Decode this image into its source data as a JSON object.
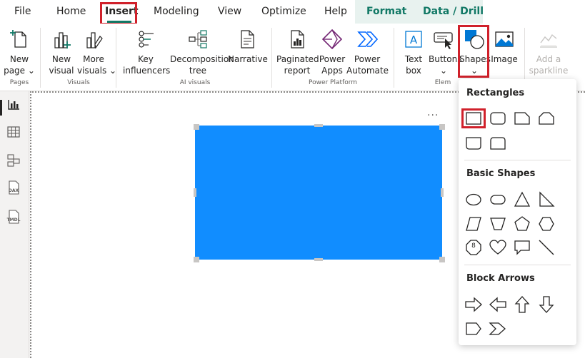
{
  "menubar": {
    "items": [
      {
        "label": "File"
      },
      {
        "label": "Home"
      },
      {
        "label": "Insert"
      },
      {
        "label": "Modeling"
      },
      {
        "label": "View"
      },
      {
        "label": "Optimize"
      },
      {
        "label": "Help"
      },
      {
        "label": "Format"
      },
      {
        "label": "Data / Drill"
      }
    ],
    "active_tab": "Insert"
  },
  "ribbon": {
    "groups": [
      {
        "label": "Pages"
      },
      {
        "label": "Visuals"
      },
      {
        "label": "AI visuals"
      },
      {
        "label": "Power Platform"
      },
      {
        "label": "Elem"
      }
    ],
    "buttons": {
      "new_page": {
        "line1": "New",
        "line2": "page ⌄"
      },
      "new_visual": {
        "line1": "New",
        "line2": "visual"
      },
      "more_visuals": {
        "line1": "More",
        "line2": "visuals ⌄"
      },
      "key_influencers": {
        "line1": "Key",
        "line2": "influencers"
      },
      "decomposition_tree": {
        "line1": "Decomposition",
        "line2": "tree"
      },
      "narrative": {
        "line1": "Narrative",
        "line2": ""
      },
      "paginated_report": {
        "line1": "Paginated",
        "line2": "report"
      },
      "power_apps": {
        "line1": "Power",
        "line2": "Apps"
      },
      "power_automate": {
        "line1": "Power",
        "line2": "Automate"
      },
      "text_box": {
        "line1": "Text",
        "line2": "box"
      },
      "buttons": {
        "line1": "Buttons",
        "line2": "⌄"
      },
      "shapes": {
        "line1": "Shapes",
        "line2": "⌄"
      },
      "image": {
        "line1": "Image",
        "line2": ""
      },
      "sparkline": {
        "line1": "Add a",
        "line2": "sparkline"
      }
    }
  },
  "rail": {
    "icons": [
      "report-view-icon",
      "table-view-icon",
      "model-view-icon",
      "dax-query-view-icon",
      "tmdl-view-icon"
    ],
    "dax_label": "DAX",
    "tmdl_label": "TMDL"
  },
  "canvas": {
    "shape_color": "#118dff",
    "more_options": "···"
  },
  "shapes_menu": {
    "sections": [
      {
        "title": "Rectangles"
      },
      {
        "title": "Basic Shapes"
      },
      {
        "title": "Block Arrows"
      }
    ],
    "octagon_label": "8"
  },
  "colors": {
    "accent_green": "#117865",
    "highlight_red": "#d0212b",
    "shape_blue": "#118dff"
  }
}
